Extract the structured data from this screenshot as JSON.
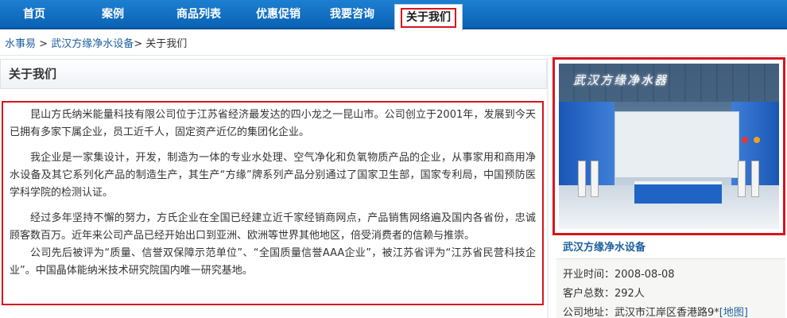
{
  "nav": {
    "items": [
      "首页",
      "案例",
      "商品列表",
      "优惠促销",
      "我要咨询"
    ],
    "active": "关于我们"
  },
  "breadcrumb": {
    "items": [
      "水事易",
      "武汉方缘净水设备"
    ],
    "separator": ">",
    "current": "关于我们"
  },
  "main": {
    "heading": "关于我们",
    "paragraphs": [
      "昆山方氏纳米能量科技有限公司位于江苏省经济最发达的四小龙之一昆山市。公司创立于2001年，发展到今天已拥有多家下属企业，员工近千人，固定资产近亿的集团化企业。",
      "我企业是一家集设计，开发，制造为一体的专业水处理、空气净化和负氧物质产品的企业，从事家用和商用净水设备及其它系列化产品的制造生产，其生产“方缘”牌系列产品分别通过了国家卫生部，国家专利局，中国预防医学科学院的检测认证。",
      "经过多年坚持不懈的努力，方氏企业在全国已经建立近千家经销商网点，产品销售网络遍及国内各省份，忠诚顾客数百万。近年来公司产品已经开始出口到亚洲、欧洲等世界其他地区，倍受消费者的信赖与推崇。",
      "公司先后被评为“质量、信誉双保障示范单位”、“全国质量信誉AAA企业”，被江苏省评为“江苏省民营科技企业”。中国晶体能纳米技术研究院国内唯一研究基地。"
    ]
  },
  "sidebar": {
    "image_caption": "武汉方缘净水器",
    "company_name": "武汉方缘净水设备",
    "info": {
      "open_label": "开业时间：",
      "open_value": "2008-08-08",
      "customers_label": "客户总数：",
      "customers_value": "292人",
      "address_label": "公司地址：",
      "address_value": "武汉市江岸区香港路9*",
      "map_link": "[地图]"
    }
  },
  "colors": {
    "nav_blue": "#0a62b4",
    "highlight_red": "#d6161d",
    "link_blue": "#1d5f9f"
  }
}
